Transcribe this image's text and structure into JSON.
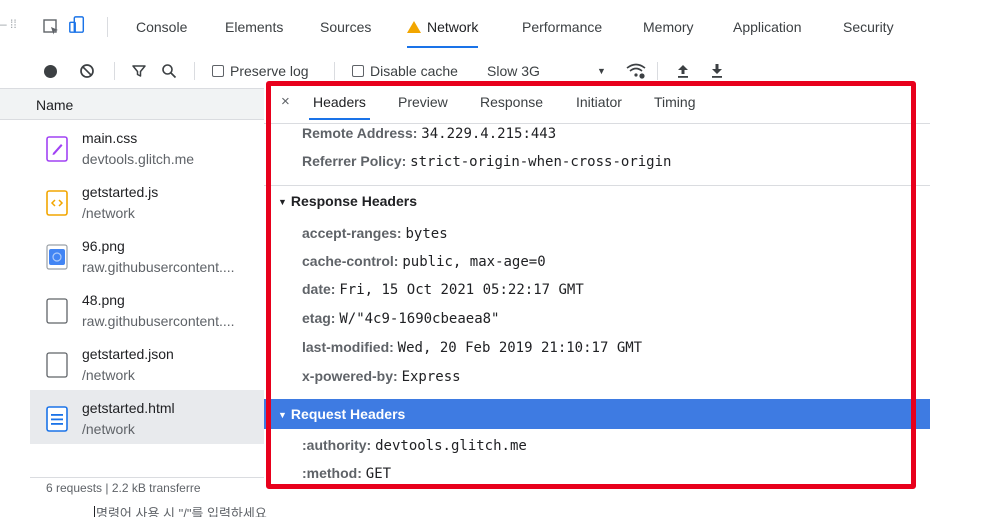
{
  "devtools": {
    "tabs": [
      {
        "label": "Console"
      },
      {
        "label": "Elements"
      },
      {
        "label": "Sources"
      },
      {
        "label": "Network"
      },
      {
        "label": "Performance"
      },
      {
        "label": "Memory"
      },
      {
        "label": "Application"
      },
      {
        "label": "Security"
      }
    ],
    "active_tab": "Network"
  },
  "toolbar": {
    "preserve_log": "Preserve log",
    "disable_cache": "Disable cache",
    "throttling": "Slow 3G"
  },
  "request_list": {
    "header": "Name",
    "items": [
      {
        "name": "main.css",
        "path": "devtools.glitch.me",
        "icon": "css-file-icon",
        "color": "#a142f4"
      },
      {
        "name": "getstarted.js",
        "path": "/network",
        "icon": "js-file-icon",
        "color": "#f2a600"
      },
      {
        "name": "96.png",
        "path": "raw.githubusercontent....",
        "icon": "image-file-icon",
        "color": "#4285f4"
      },
      {
        "name": "48.png",
        "path": "raw.githubusercontent....",
        "icon": "blank-file-icon",
        "color": "#5f6368"
      },
      {
        "name": "getstarted.json",
        "path": "/network",
        "icon": "blank-file-icon",
        "color": "#5f6368"
      },
      {
        "name": "getstarted.html",
        "path": "/network",
        "icon": "document-file-icon",
        "color": "#1a73e8"
      }
    ],
    "footer": "6 requests  |  2.2 kB transferre"
  },
  "details": {
    "tabs": [
      {
        "label": "Headers"
      },
      {
        "label": "Preview"
      },
      {
        "label": "Response"
      },
      {
        "label": "Initiator"
      },
      {
        "label": "Timing"
      }
    ],
    "active_tab": "Headers",
    "general": [
      {
        "key": "Remote Address:",
        "value": "34.229.4.215:443"
      },
      {
        "key": "Referrer Policy:",
        "value": "strict-origin-when-cross-origin"
      }
    ],
    "response_headers_title": "Response Headers",
    "response_headers": [
      {
        "key": "accept-ranges:",
        "value": "bytes"
      },
      {
        "key": "cache-control:",
        "value": "public, max-age=0"
      },
      {
        "key": "date:",
        "value": "Fri, 15 Oct 2021 05:22:17 GMT"
      },
      {
        "key": "etag:",
        "value": "W/\"4c9-1690cbeaea8\""
      },
      {
        "key": "last-modified:",
        "value": "Wed, 20 Feb 2019 21:10:17 GMT"
      },
      {
        "key": "x-powered-by:",
        "value": "Express"
      }
    ],
    "request_headers_title": "Request Headers",
    "request_headers": [
      {
        "key": ":authority:",
        "value": "devtools.glitch.me"
      },
      {
        "key": ":method:",
        "value": "GET"
      }
    ]
  },
  "ime_hint": "명령어 사용 시 \"/\"를 입력하세요",
  "colors": {
    "accent": "#1a73e8",
    "highlight_border": "#e8001c",
    "selected_section": "#3e7be2"
  }
}
